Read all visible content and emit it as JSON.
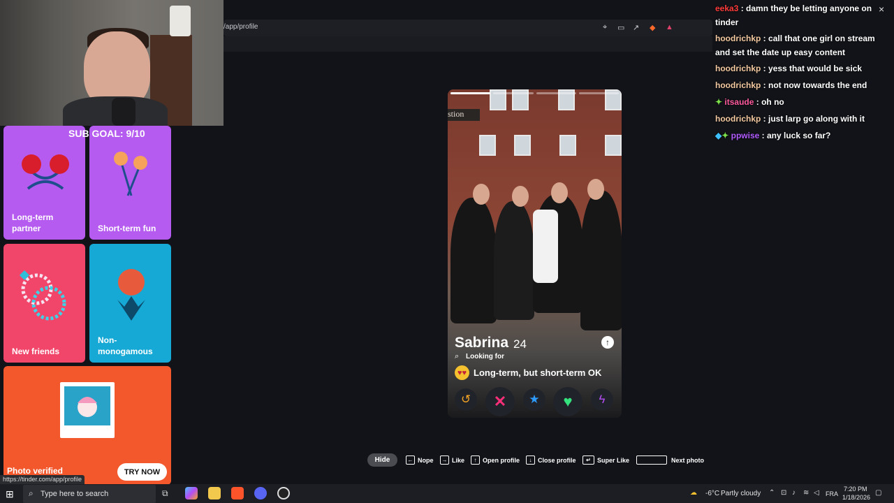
{
  "browser": {
    "url": "/app/profile"
  },
  "stream": {
    "sub_goal": "SUB GOAL: 9/10"
  },
  "relationship_cards": [
    {
      "label": "Long-term partner"
    },
    {
      "label": "Short-term fun"
    },
    {
      "label": "New friends"
    },
    {
      "label": "Non-monogamous"
    }
  ],
  "verified_card": {
    "label": "Photo verified",
    "button": "TRY NOW"
  },
  "status_bar_url": "https://tinder.com/app/profile",
  "profile": {
    "photo_sign_text": "stion",
    "name": "Sabrina",
    "age": "24",
    "looking_for_label": "Looking for",
    "looking_for_value": "Long-term, but short-term OK",
    "photo_count": 4,
    "current_photo": 1
  },
  "actions": {
    "rewind_icon": "rewind-icon",
    "nope_icon": "x-icon",
    "superlike_icon": "star-icon",
    "like_icon": "heart-icon",
    "boost_icon": "lightning-icon"
  },
  "hints": {
    "hide": "Hide",
    "nope": "Nope",
    "like": "Like",
    "open_profile": "Open profile",
    "close_profile": "Close profile",
    "super_like": "Super Like",
    "next_photo": "Next photo"
  },
  "chat": [
    {
      "user": "eeka3",
      "color": "#ff3b3b",
      "message": "damn they be letting anyone on tinder"
    },
    {
      "user": "hoodrichkp",
      "color": "#f2c8a0",
      "message": "call that one girl on stream and set the date up easy content"
    },
    {
      "user": "hoodrichkp",
      "color": "#f2c8a0",
      "message": "yess that would be sick"
    },
    {
      "user": "hoodrichkp",
      "color": "#f2c8a0",
      "message": "not now towards the end"
    },
    {
      "user": "itsaude",
      "color": "#ff5a9e",
      "message": "oh no"
    },
    {
      "user": "hoodrichkp",
      "color": "#f2c8a0",
      "message": "just larp go along with it"
    },
    {
      "user": "ppwise",
      "color": "#b25cff",
      "message": "any luck so far?"
    }
  ],
  "taskbar": {
    "search_placeholder": "Type here to search",
    "weather_temp": "-6°C",
    "weather_condition": "Partly cloudy",
    "language": "FRA",
    "time": "7:20 PM",
    "date": "1/18/2026"
  }
}
